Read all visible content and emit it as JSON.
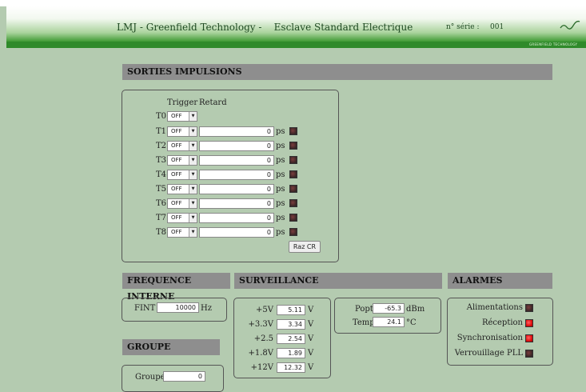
{
  "banner": {
    "title": "LMJ - Greenfield Technology -    Esclave Standard Electrique",
    "serial_label": "n° série :",
    "serial_value": "001",
    "logo_text": "GREENFIELD TECHNOLOGY",
    "logo_icon": "signal-wave-icon"
  },
  "sorties": {
    "header": "SORTIES IMPULSIONS",
    "col_trigger": "Trigger",
    "col_retard": "Retard",
    "t0": {
      "label": "T0",
      "trigger": "OFF"
    },
    "channels": [
      {
        "label": "T1",
        "trigger": "OFF",
        "retard": "0",
        "unit": "ps",
        "led": "off"
      },
      {
        "label": "T2",
        "trigger": "OFF",
        "retard": "0",
        "unit": "ps",
        "led": "off"
      },
      {
        "label": "T3",
        "trigger": "OFF",
        "retard": "0",
        "unit": "ps",
        "led": "off"
      },
      {
        "label": "T4",
        "trigger": "OFF",
        "retard": "0",
        "unit": "ps",
        "led": "off"
      },
      {
        "label": "T5",
        "trigger": "OFF",
        "retard": "0",
        "unit": "ps",
        "led": "off"
      },
      {
        "label": "T6",
        "trigger": "OFF",
        "retard": "0",
        "unit": "ps",
        "led": "off"
      },
      {
        "label": "T7",
        "trigger": "OFF",
        "retard": "0",
        "unit": "ps",
        "led": "off"
      },
      {
        "label": "T8",
        "trigger": "OFF",
        "retard": "0",
        "unit": "ps",
        "led": "off"
      }
    ],
    "raz_button": "Raz CR"
  },
  "frequence": {
    "header": "FREQUENCE INTERNE",
    "label": "FINT",
    "value": "10000",
    "unit": "Hz"
  },
  "groupe": {
    "header": "GROUPE",
    "label": "Groupe",
    "value": "0"
  },
  "surveillance": {
    "header": "SURVEILLANCE",
    "voltages": [
      {
        "label": "+5V",
        "value": "5.11",
        "unit": "V"
      },
      {
        "label": "+3.3V",
        "value": "3.34",
        "unit": "V"
      },
      {
        "label": "+2.5",
        "value": "2.54",
        "unit": "V"
      },
      {
        "label": "+1.8V",
        "value": "1.89",
        "unit": "V"
      },
      {
        "label": "+12V",
        "value": "12.32",
        "unit": "V"
      }
    ],
    "popt": {
      "label": "Popt",
      "value": "-65.3",
      "unit": "dBm"
    },
    "temp": {
      "label": "Temp",
      "value": "24.1",
      "unit": "°C"
    }
  },
  "alarmes": {
    "header": "ALARMES",
    "items": [
      {
        "label": "Alimentations",
        "state": "off"
      },
      {
        "label": "Réception",
        "state": "on"
      },
      {
        "label": "Synchronisation",
        "state": "on"
      },
      {
        "label": "Verrouillage PLL",
        "state": "off"
      }
    ]
  },
  "colors": {
    "background": "#b4cbb0",
    "banner_green": "#2f8a2a",
    "section_header": "#8e8e8e",
    "alarm_on": "#e01010",
    "alarm_off": "#4a2e2e"
  }
}
